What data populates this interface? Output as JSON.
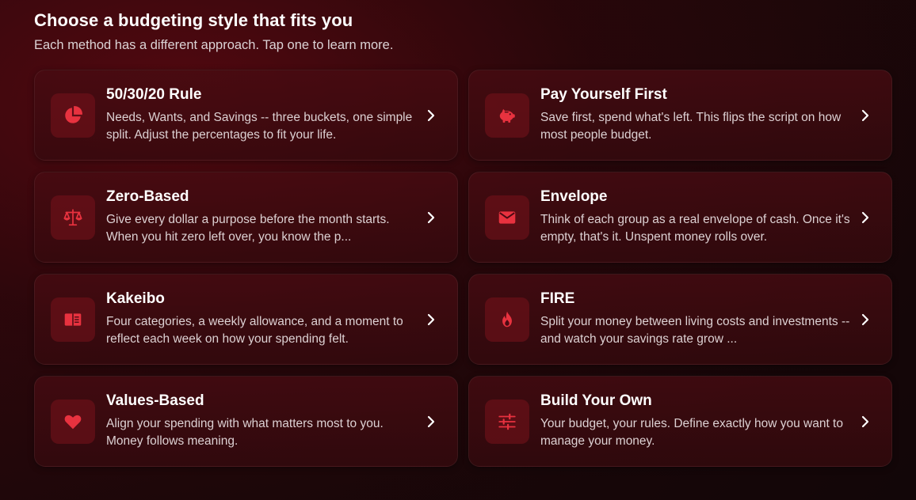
{
  "header": {
    "title": "Choose a budgeting style that fits you",
    "subtitle": "Each method has a different approach. Tap one to learn more."
  },
  "accent_color": "#e8323f",
  "cards": [
    {
      "title": "50/30/20 Rule",
      "description": "Needs, Wants, and Savings -- three buckets, one simple split. Adjust the percentages to fit your life.",
      "icon": "pie-chart-icon"
    },
    {
      "title": "Pay Yourself First",
      "description": "Save first, spend what's left. This flips the script on how most people budget.",
      "icon": "piggy-bank-icon"
    },
    {
      "title": "Zero-Based",
      "description": "Give every dollar a purpose before the month starts. When you hit zero left over, you know the p...",
      "icon": "scale-icon"
    },
    {
      "title": "Envelope",
      "description": "Think of each group as a real envelope of cash. Once it's empty, that's it. Unspent money rolls over.",
      "icon": "envelope-icon"
    },
    {
      "title": "Kakeibo",
      "description": "Four categories, a weekly allowance, and a moment to reflect each week on how your spending felt.",
      "icon": "book-icon"
    },
    {
      "title": "FIRE",
      "description": "Split your money between living costs and investments -- and watch your savings rate grow ...",
      "icon": "flame-icon"
    },
    {
      "title": "Values-Based",
      "description": "Align your spending with what matters most to you. Money follows meaning.",
      "icon": "heart-icon"
    },
    {
      "title": "Build Your Own",
      "description": "Your budget, your rules. Define exactly how you want to manage your money.",
      "icon": "sliders-icon"
    }
  ]
}
